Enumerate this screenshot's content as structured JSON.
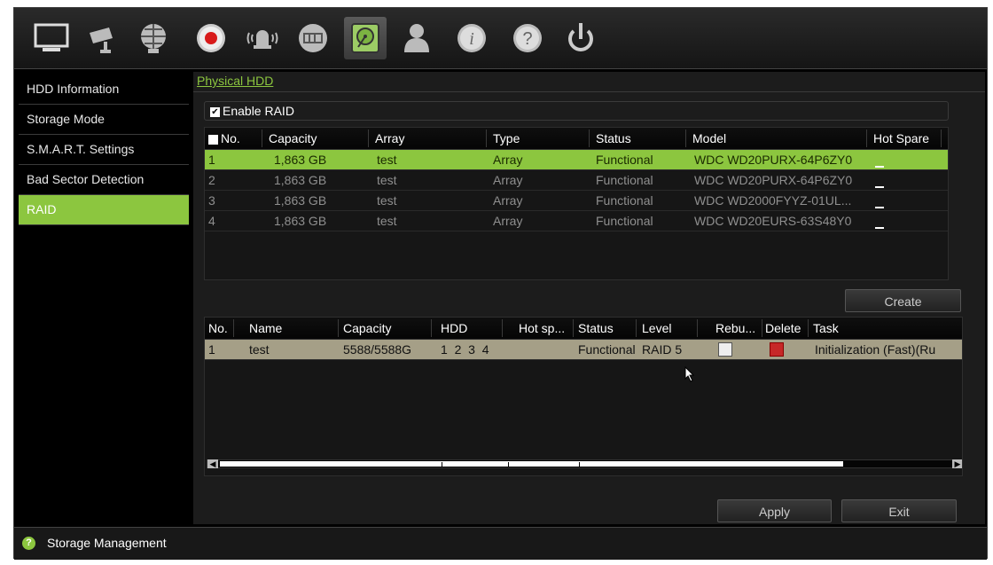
{
  "toolbar": {
    "icons": [
      "monitor-icon",
      "camera-icon",
      "network-icon",
      "record-icon",
      "alarm-icon",
      "device-icon",
      "storage-icon",
      "user-icon",
      "info-icon",
      "help-icon",
      "power-icon"
    ]
  },
  "sidebar": {
    "items": [
      {
        "label": "HDD Information"
      },
      {
        "label": "Storage Mode"
      },
      {
        "label": "S.M.A.R.T. Settings"
      },
      {
        "label": "Bad Sector Detection"
      },
      {
        "label": "RAID"
      }
    ]
  },
  "main": {
    "tab": "Physical HDD",
    "enable_raid": {
      "label": "Enable RAID",
      "checked": "✔"
    },
    "physical_table": {
      "headers": [
        "No.",
        "Capacity",
        "Array",
        "Type",
        "Status",
        "Model",
        "Hot Spare"
      ],
      "rows": [
        {
          "no": "1",
          "capacity": "1,863 GB",
          "array": "test",
          "type": "Array",
          "status": "Functional",
          "model": "WDC WD20PURX-64P6ZY0"
        },
        {
          "no": "2",
          "capacity": "1,863 GB",
          "array": "test",
          "type": "Array",
          "status": "Functional",
          "model": "WDC WD20PURX-64P6ZY0"
        },
        {
          "no": "3",
          "capacity": "1,863 GB",
          "array": "test",
          "type": "Array",
          "status": "Functional",
          "model": "WDC WD2000FYYZ-01UL..."
        },
        {
          "no": "4",
          "capacity": "1,863 GB",
          "array": "test",
          "type": "Array",
          "status": "Functional",
          "model": "WDC WD20EURS-63S48Y0"
        }
      ]
    },
    "create_label": "Create",
    "raid_table": {
      "headers": [
        "No.",
        "Name",
        "Capacity",
        "HDD",
        "Hot sp...",
        "Status",
        "Level",
        "Rebu...",
        "Delete",
        "Task"
      ],
      "rows": [
        {
          "no": "1",
          "name": "test",
          "capacity": "5588/5588G",
          "hdd": "1  2  3  4",
          "hot_spare": "",
          "status": "Functional",
          "level": "RAID 5",
          "task": "Initialization (Fast)(Ru"
        }
      ]
    },
    "apply_label": "Apply",
    "exit_label": "Exit"
  },
  "statusbar": {
    "icon": "help-icon",
    "text": "Storage Management"
  },
  "colors": {
    "accent": "#8cc63f",
    "raid_row": "#a59f87",
    "background": "#000000"
  }
}
